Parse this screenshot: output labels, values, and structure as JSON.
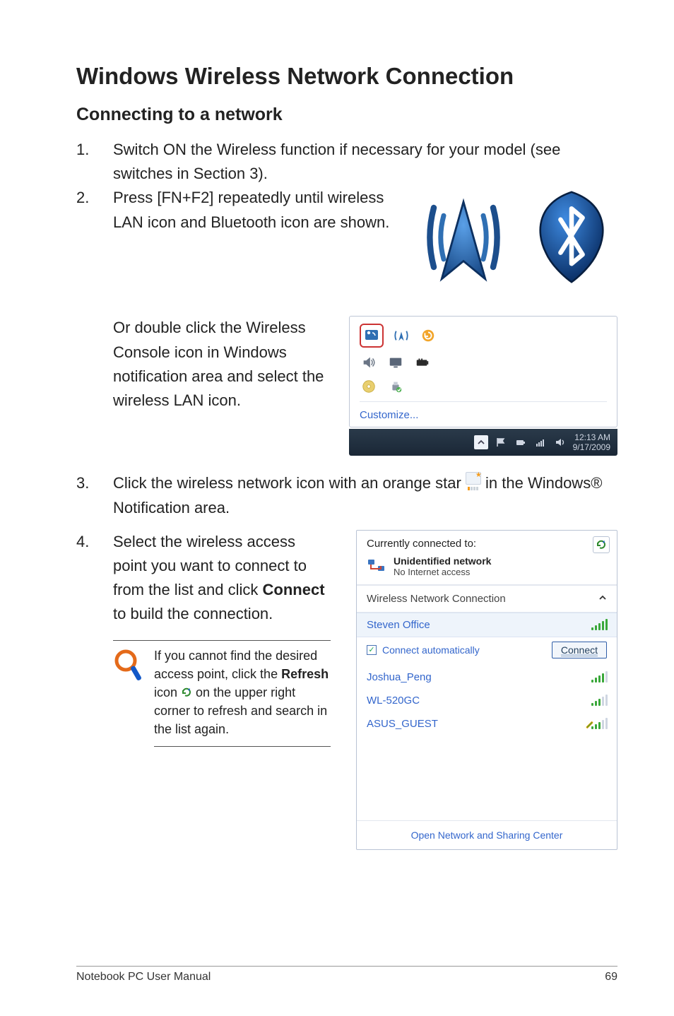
{
  "headings": {
    "h1": "Windows Wireless Network Connection",
    "h2": "Connecting to a network"
  },
  "steps": {
    "s1": {
      "num": "1.",
      "text": "Switch ON the Wireless function if necessary for your model (see switches in Section 3)."
    },
    "s2": {
      "num": "2.",
      "text": "Press [FN+F2] repeatedly until wireless LAN icon and Bluetooth icon are shown."
    },
    "s2b": "Or double click the Wireless Console icon in Windows notification area and select the wireless LAN icon.",
    "s3": {
      "num": "3.",
      "pre": "Click the wireless network icon with an orange star ",
      "post": " in the Windows® Notification area."
    },
    "s4": {
      "num": "4.",
      "pre": "Select the wireless access point you want to connect to from the list and click ",
      "bold": "Connect",
      "post": " to build the connection."
    }
  },
  "note": {
    "pre": "If you cannot find the desired access point, click the ",
    "bold": "Refresh",
    "mid": " icon ",
    "post": " on the upper right corner to refresh and search in the list again."
  },
  "notif": {
    "customize": "Customize...",
    "time": "12:13 AM",
    "date": "9/17/2009"
  },
  "wifi": {
    "currently": "Currently connected to:",
    "net_name": "Unidentified network",
    "net_sub": "No Internet access",
    "section": "Wireless Network Connection",
    "items": [
      {
        "name": "Steven Office"
      },
      {
        "name": "Joshua_Peng"
      },
      {
        "name": "WL-520GC"
      },
      {
        "name": "ASUS_GUEST"
      }
    ],
    "auto": "Connect automatically",
    "connect_btn": "Connect",
    "footer": "Open Network and Sharing Center"
  },
  "footer": {
    "left": "Notebook PC User Manual",
    "right": "69"
  }
}
